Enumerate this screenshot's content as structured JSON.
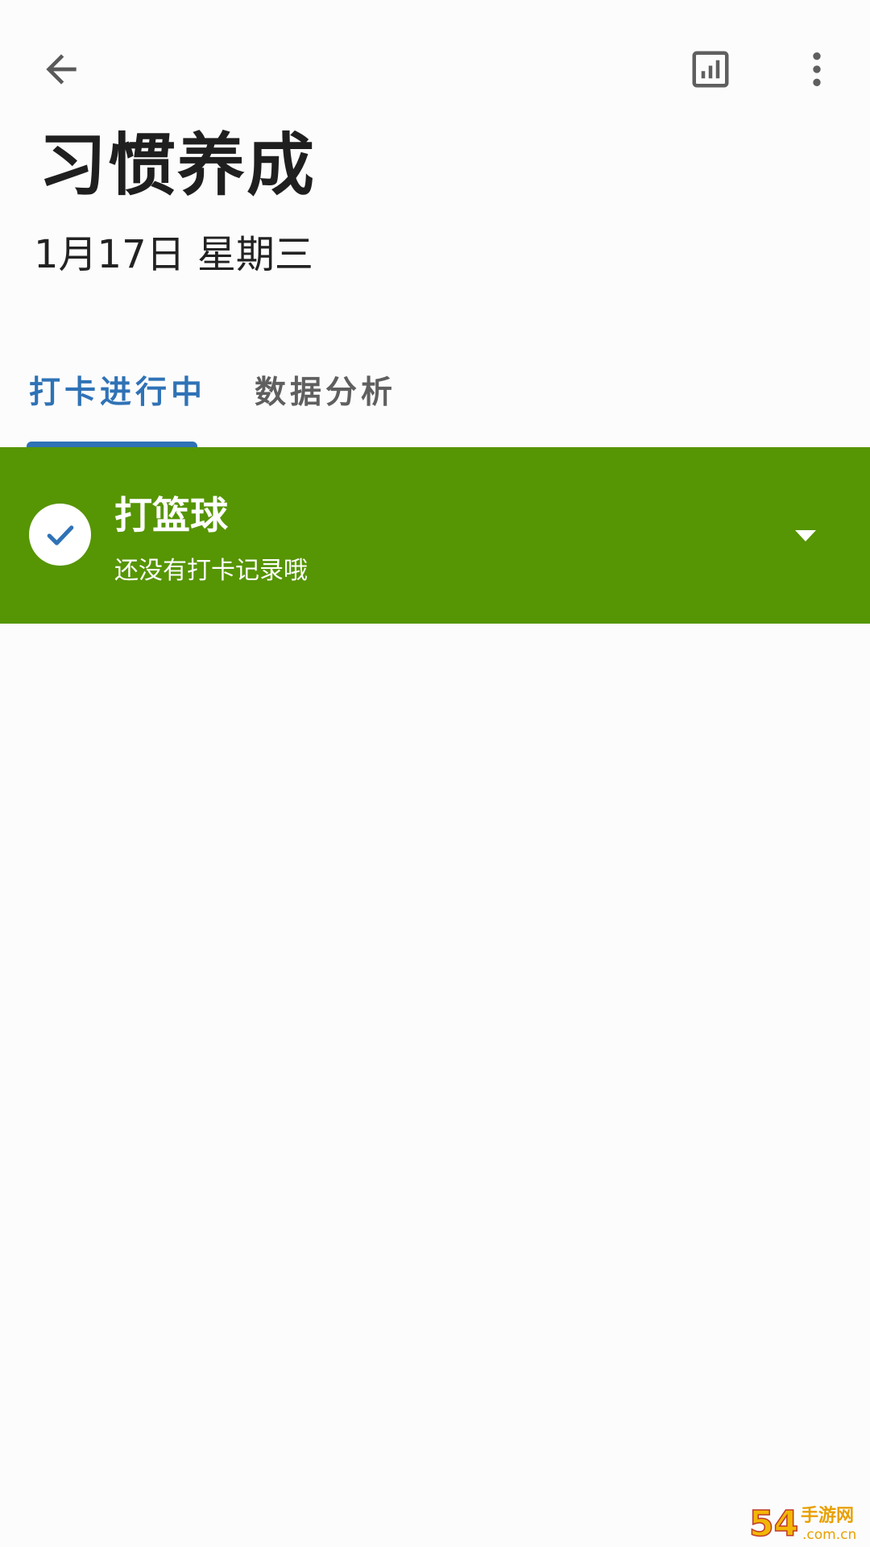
{
  "header": {
    "back_icon": "arrow-back-icon",
    "stats_icon": "bar-chart-box-icon",
    "more_icon": "more-vertical-icon",
    "title": "习惯养成",
    "date": "1月17日 星期三"
  },
  "tabs": [
    {
      "label": "打卡进行中",
      "active": true
    },
    {
      "label": "数据分析",
      "active": false
    }
  ],
  "habits": [
    {
      "name": "打篮球",
      "status": "还没有打卡记录哦",
      "checked": true,
      "card_color": "#569503"
    }
  ],
  "colors": {
    "accent": "#2f72b6",
    "card_green": "#569503",
    "background": "#fcfcfc"
  },
  "watermark": {
    "brand": "54",
    "name": "手游网",
    "domain": ".com.cn"
  }
}
